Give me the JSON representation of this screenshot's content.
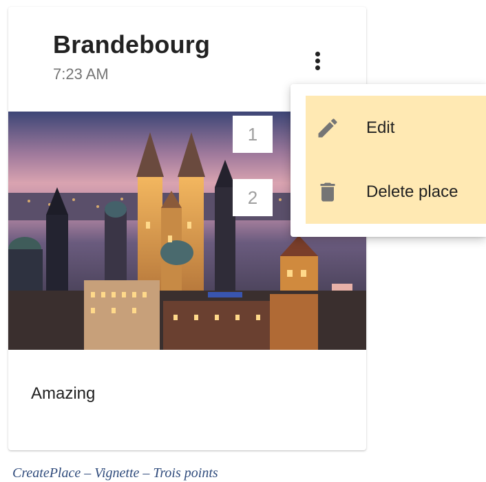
{
  "card": {
    "title": "Brandebourg",
    "time": "7:23 AM",
    "image_alt": "night view of a city with gothic towers",
    "description": "Amazing",
    "more_icon": "more-vert-icon"
  },
  "badges": [
    "1",
    "2"
  ],
  "menu": {
    "items": [
      {
        "label": "Edit",
        "icon": "pencil-icon"
      },
      {
        "label": "Delete place",
        "icon": "trash-icon"
      }
    ],
    "highlight_color": "#FFE9B3",
    "icon_color": "#757575"
  },
  "caption": "CreatePlace – Vignette – Trois points"
}
